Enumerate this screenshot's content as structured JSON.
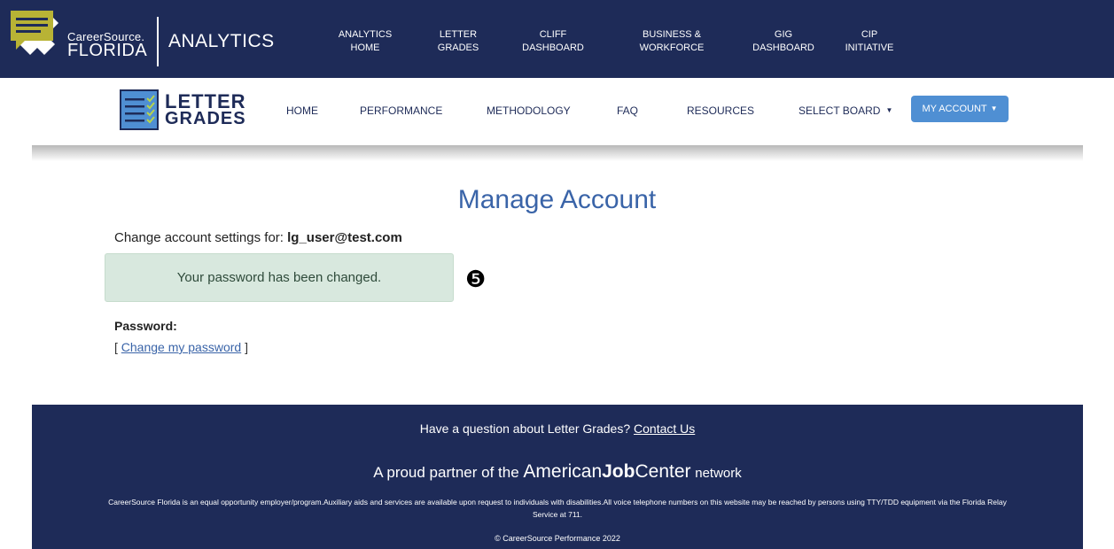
{
  "top_bar": {
    "brand_line1": "CareerSource.",
    "brand_line2": "FLORIDA",
    "section": "ANALYTICS",
    "nav": [
      {
        "line1": "ANALYTICS",
        "line2": "HOME"
      },
      {
        "line1": "LETTER",
        "line2": "GRADES"
      },
      {
        "line1": "CLIFF",
        "line2": "DASHBOARD"
      },
      {
        "line1": "BUSINESS &",
        "line2": "WORKFORCE"
      },
      {
        "line1": "GIG",
        "line2": "DASHBOARD"
      },
      {
        "line1": "CIP",
        "line2": "INITIATIVE"
      }
    ]
  },
  "sub_nav": {
    "logo_line1": "LETTER",
    "logo_line2": "GRADES",
    "items": [
      "HOME",
      "PERFORMANCE",
      "METHODOLOGY",
      "FAQ",
      "RESOURCES"
    ],
    "select_board": "SELECT BOARD",
    "account": "MY ACCOUNT"
  },
  "main": {
    "title": "Manage Account",
    "settings_prefix": "Change account settings for:",
    "user_email": "lg_user@test.com",
    "alert": "Your password has been changed.",
    "step_marker": "❺",
    "password_label": "Password:",
    "bracket_open": "[",
    "change_password_link": "Change my password",
    "bracket_close": "]"
  },
  "footer": {
    "question": "Have a question about Letter Grades?",
    "contact_link": "Contact Us",
    "partner_prefix": "A proud partner of the",
    "ajc_american": "American",
    "ajc_job": "Job",
    "ajc_center": "Center",
    "partner_suffix": "network",
    "eeo_text": "CareerSource Florida is an equal opportunity employer/program.Auxiliary aids and services are available upon request to individuals with disabilities.All voice telephone numbers on this website may be reached by persons using TTY/TDD equipment via the Florida Relay Service at 711.",
    "copyright": "© CareerSource Performance 2022"
  },
  "colors": {
    "navy": "#1e2b58",
    "accent_blue": "#4f8fd3",
    "title_blue": "#3a64a8",
    "alert_bg": "#d8e8de"
  }
}
